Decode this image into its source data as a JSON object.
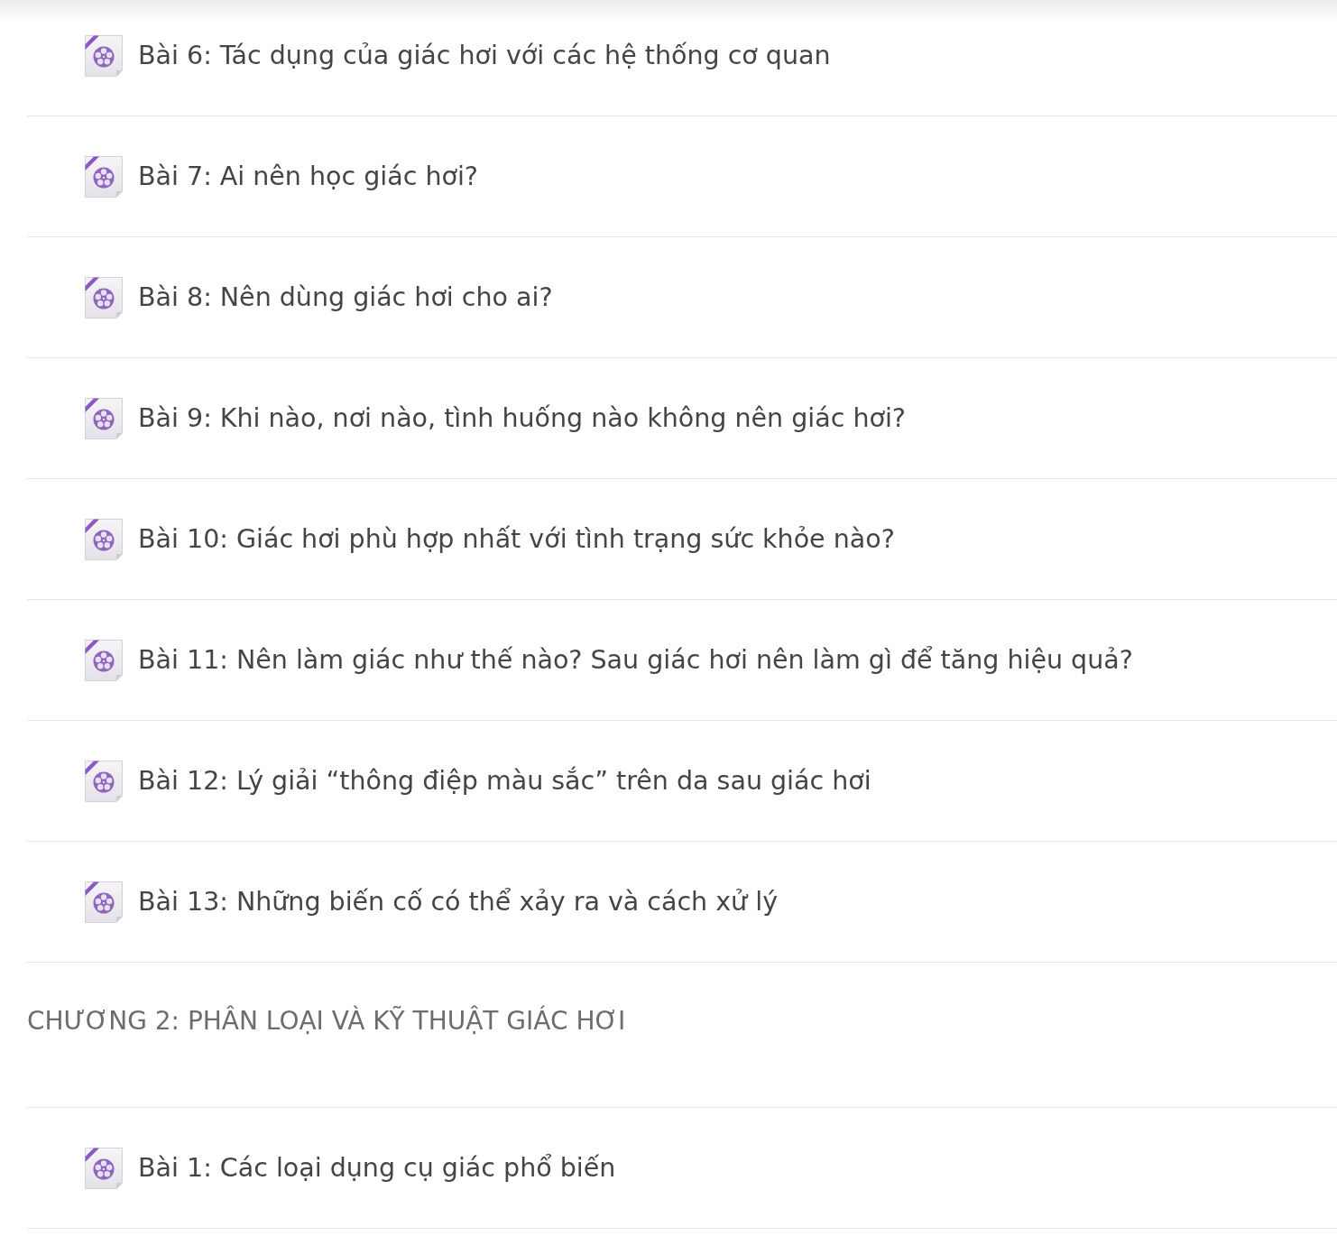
{
  "chapters": [
    {
      "lessons": [
        {
          "title": "Bài 6: Tác dụng của giác hơi với các hệ thống cơ quan"
        },
        {
          "title": "Bài 7: Ai nên học giác hơi?"
        },
        {
          "title": "Bài 8: Nên dùng giác hơi cho ai?"
        },
        {
          "title": "Bài 9: Khi nào, nơi nào, tình huống nào không nên giác hơi?"
        },
        {
          "title": "Bài 10: Giác hơi phù hợp nhất với tình trạng sức khỏe nào?"
        },
        {
          "title": "Bài 11: Nên làm giác như thế nào? Sau giác hơi nên làm gì để tăng hiệu quả?"
        },
        {
          "title": "Bài 12: Lý giải “thông điệp màu sắc” trên da sau giác hơi"
        },
        {
          "title": "Bài 13: Những biến cố có thể xảy ra và cách xử lý"
        }
      ]
    },
    {
      "title": "CHƯƠNG 2: PHÂN LOẠI VÀ KỸ THUẬT GIÁC HƠI",
      "lessons": [
        {
          "title": "Bài 1: Các loại dụng cụ giác phổ biến"
        }
      ]
    }
  ]
}
